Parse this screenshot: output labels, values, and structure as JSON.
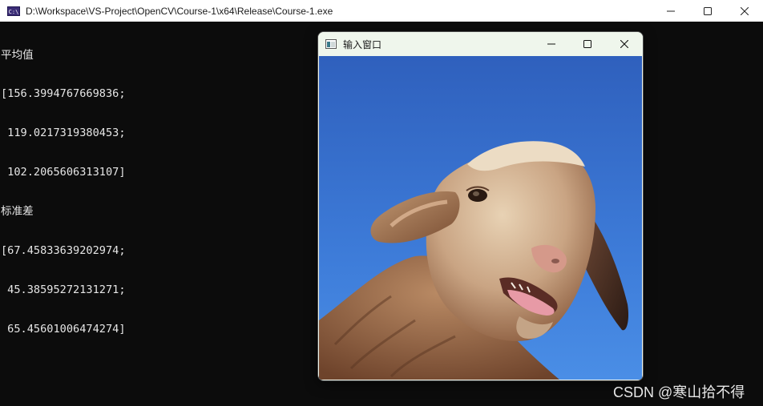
{
  "console": {
    "title": "D:\\Workspace\\VS-Project\\OpenCV\\Course-1\\x64\\Release\\Course-1.exe",
    "icon_label": "C:\\",
    "lines": [
      "平均值",
      "[156.3994767669836;",
      " 119.0217319380453;",
      " 102.2065606313107]",
      "标准差",
      "[67.45833639202974;",
      " 45.38595272131271;",
      " 65.45601006474274]"
    ]
  },
  "image_window": {
    "title": "输入窗口",
    "content": "sheep-photo"
  },
  "watermark": {
    "text": "CSDN @寒山拾不得"
  },
  "colors": {
    "console_bg": "#0c0c0c",
    "console_text": "#e6e6e6",
    "sky_top": "#2f63c0",
    "sky_bottom": "#4a8ee6",
    "wool": "#c9a887"
  },
  "icons": {
    "minimize": "minimize-icon",
    "maximize": "maximize-icon",
    "close": "close-icon",
    "app": "console-app-icon",
    "window": "window-icon"
  }
}
